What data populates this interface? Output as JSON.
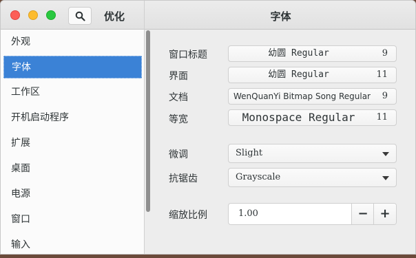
{
  "app": {
    "title": "优化"
  },
  "header": {
    "page_title": "字体"
  },
  "sidebar": {
    "items": [
      {
        "label": "外观",
        "active": false
      },
      {
        "label": "字体",
        "active": true
      },
      {
        "label": "工作区",
        "active": false
      },
      {
        "label": "开机启动程序",
        "active": false
      },
      {
        "label": "扩展",
        "active": false
      },
      {
        "label": "桌面",
        "active": false
      },
      {
        "label": "电源",
        "active": false
      },
      {
        "label": "窗口",
        "active": false
      },
      {
        "label": "输入",
        "active": false
      }
    ]
  },
  "fonts": {
    "window_title": {
      "label": "窗口标题",
      "name": "幼圆 Regular",
      "size": "9"
    },
    "interface": {
      "label": "界面",
      "name": "幼圆 Regular",
      "size": "11"
    },
    "document": {
      "label": "文档",
      "name": "WenQuanYi Bitmap Song Regular",
      "size": "9"
    },
    "monospace": {
      "label": "等宽",
      "name": "Monospace Regular",
      "size": "11"
    }
  },
  "hinting": {
    "label": "微调",
    "value": "Slight"
  },
  "antialiasing": {
    "label": "抗锯齿",
    "value": "Grayscale"
  },
  "scaling": {
    "label": "缩放比例",
    "value": "1.00",
    "minus": "−",
    "plus": "+"
  },
  "icons": {
    "search": "search-icon",
    "dropdown": "chevron-down-icon"
  }
}
